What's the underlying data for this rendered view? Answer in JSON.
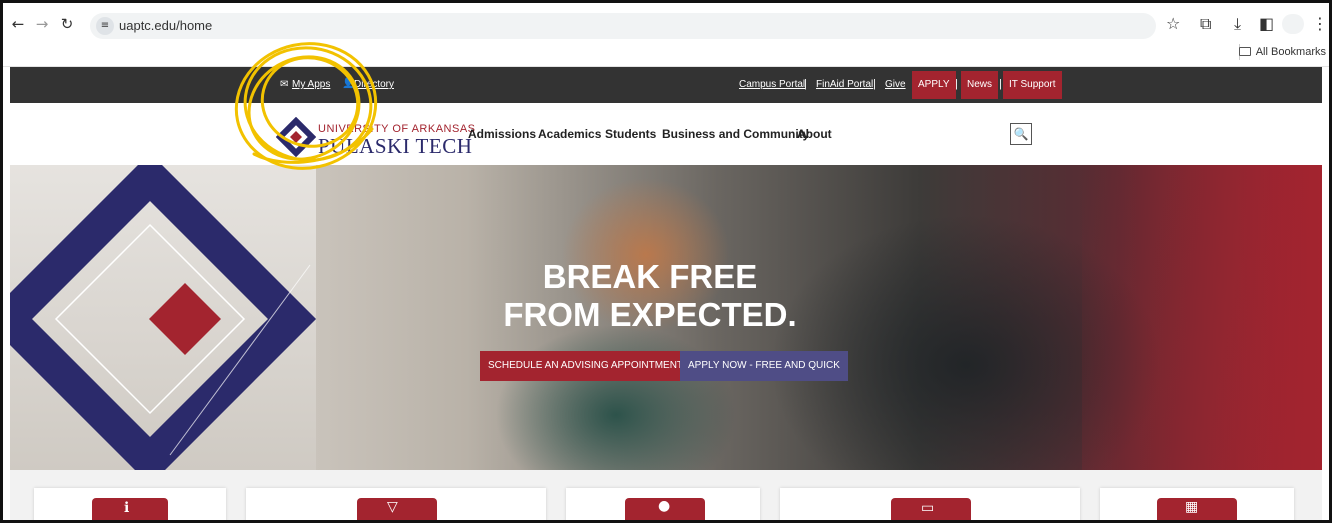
{
  "browser": {
    "url": "uaptc.edu/home",
    "bookmarks_label": "All Bookmarks"
  },
  "utility_bar": {
    "left_links": [
      "My Apps",
      "Directory"
    ],
    "right_links": [
      "Campus Portal",
      "FinAid Portal",
      "Give"
    ],
    "buttons": [
      "APPLY",
      "News",
      "IT Support"
    ],
    "separator": "|"
  },
  "logo": {
    "line1": "UNIVERSITY OF ARKANSAS",
    "line2": "PULASKI TECH"
  },
  "nav": {
    "items": [
      "Admissions",
      "Academics",
      "Students",
      "Business and Community",
      "About"
    ]
  },
  "hero": {
    "title_line1": "BREAK FREE",
    "title_line2": "FROM EXPECTED.",
    "button_primary": "SCHEDULE AN ADVISING APPOINTMENT",
    "button_secondary": "APPLY NOW - FREE AND QUICK"
  },
  "colors": {
    "brand_red": "#a3242f",
    "brand_navy": "#2b2a6b",
    "button_purple": "#4f4d86",
    "utility_bg": "#333333",
    "annotation_yellow": "#f2c200"
  }
}
